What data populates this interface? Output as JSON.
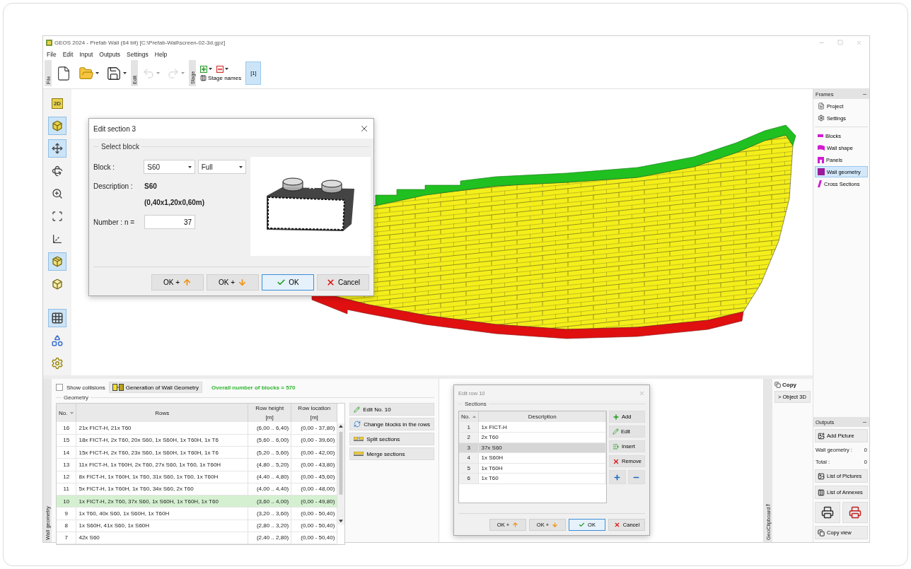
{
  "window": {
    "title": "GEOS 2024 - Prefab Wall (64 bit) [C:\\Prefab-Wall\\screen-02-3d.gpz]"
  },
  "menu": [
    "File",
    "Edit",
    "Input",
    "Outputs",
    "Settings",
    "Help"
  ],
  "toolbar": {
    "groups": [
      {
        "label": "File",
        "tools": [
          {
            "kind": "new",
            "dropdown": false,
            "disabled": false
          },
          {
            "kind": "open",
            "dropdown": true,
            "disabled": false
          },
          {
            "kind": "save",
            "dropdown": true,
            "disabled": false
          }
        ]
      },
      {
        "label": "Edit",
        "tools": [
          {
            "kind": "undo",
            "dropdown": true,
            "disabled": true
          },
          {
            "kind": "redo",
            "dropdown": true,
            "disabled": true
          }
        ]
      }
    ],
    "stage": {
      "label": "Stage",
      "add": {
        "dropdown": true
      },
      "remove": {
        "dropdown": true
      },
      "names": "Stage names",
      "tabs": [
        {
          "label": "[1]",
          "selected": true
        }
      ]
    }
  },
  "view_tools": [
    {
      "kind": "planar",
      "label": "2D",
      "selected": false
    },
    {
      "kind": "spatial",
      "selected": true
    },
    {
      "kind": "move",
      "selected": true
    },
    {
      "kind": "rotate",
      "selected": false
    },
    {
      "kind": "zoom",
      "selected": false
    },
    {
      "kind": "fit",
      "selected": false
    },
    {
      "kind": "axes",
      "selected": false
    },
    {
      "kind": "view-cube",
      "selected": true
    },
    {
      "kind": "view-iso",
      "selected": false
    }
  ],
  "display_tools": [
    {
      "kind": "table",
      "selected": true
    },
    {
      "kind": "legend",
      "selected": false
    },
    {
      "kind": "settings",
      "selected": false
    }
  ],
  "frames": {
    "title": "Frames",
    "general": [
      {
        "kind": "project",
        "label": "Project",
        "selected": false
      },
      {
        "kind": "settings",
        "label": "Settings",
        "selected": false
      }
    ],
    "input": [
      {
        "kind": "blocks",
        "label": "Blocks",
        "selected": false
      },
      {
        "kind": "wall-shape",
        "label": "Wall shape",
        "selected": false
      },
      {
        "kind": "panels",
        "label": "Panels",
        "selected": false
      },
      {
        "kind": "wall-geometry",
        "label": "Wall geometry",
        "selected": true
      },
      {
        "kind": "cross-sections",
        "label": "Cross Sections",
        "selected": false
      }
    ]
  },
  "edit_section_dialog": {
    "title": "Edit section 3",
    "fieldset": "Select block",
    "block": {
      "label": "Block :",
      "type": "S60",
      "variant": "Full"
    },
    "description": {
      "label": "Description :",
      "name": "S60",
      "size": "(0,40x1,20x0,60m)"
    },
    "number": {
      "label": "Number : n =",
      "value": "37"
    },
    "footer": [
      {
        "kind": "ok-up",
        "label": "OK +",
        "default": false
      },
      {
        "kind": "ok-down",
        "label": "OK +",
        "default": false
      },
      {
        "kind": "ok",
        "label": "OK",
        "default": true
      },
      {
        "kind": "cancel",
        "label": "Cancel",
        "default": false
      }
    ]
  },
  "geometry_panel": {
    "tab": "Wall geometry",
    "show_collisions": {
      "label": "Show collisions",
      "checked": false
    },
    "generate_button": "Generation of Wall Geometry",
    "summary": "Overall number of blocks = 570",
    "fieldset": "Geometry",
    "table": {
      "sort_descending": true,
      "columns": [
        {
          "label": "No.",
          "sorted": true
        },
        {
          "label": "Rows",
          "sorted": false
        },
        {
          "label": "Row height",
          "unit": "[m]",
          "sorted": false
        },
        {
          "label": "Row location",
          "unit": "[m]",
          "sorted": false
        }
      ],
      "rows": [
        {
          "no": "16",
          "rows": "21x FICT-H, 21x T60",
          "height": "(6,00 .. 6,40)",
          "location": "(0,00 - 37,80)",
          "selected": false
        },
        {
          "no": "15",
          "rows": "18x FICT-H, 2x T60, 20x S60, 1x S60H, 1x T60H, 1x T6",
          "height": "(5,60 .. 6,00)",
          "location": "(0,00 - 39,60)",
          "selected": false
        },
        {
          "no": "14",
          "rows": "15x FICT-H, 2x T60, 23x S60, 1x S60H, 1x T60H, 1x T6",
          "height": "(5,20 .. 5,60)",
          "location": "(0,00 - 42,00)",
          "selected": false
        },
        {
          "no": "13",
          "rows": "11x FICT-H, 1x T60H, 2x T60, 27x S60, 1x T60, 1x T60H",
          "height": "(4,80 .. 5,20)",
          "location": "(0,00 - 43,80)",
          "selected": false
        },
        {
          "no": "12",
          "rows": "8x FICT-H, 1x T60H, 1x T60, 31x S60, 1x T60, 1x T60H",
          "height": "(4,40 .. 4,80)",
          "location": "(0,00 - 45,60)",
          "selected": false
        },
        {
          "no": "11",
          "rows": "5x FICT-H, 1x T60H, 1x T60, 34x S60, 2x T60",
          "height": "(4,00 .. 4,40)",
          "location": "(0,00 - 48,00)",
          "selected": false
        },
        {
          "no": "10",
          "rows": "1x FICT-H, 2x T60, 37x S60, 1x S60H, 1x T60H, 1x T60",
          "height": "(3,60 .. 4,00)",
          "location": "(0,00 - 49,80)",
          "selected": true
        },
        {
          "no": "9",
          "rows": "1x T60, 40x S60, 1x S60H, 1x T60H",
          "height": "(3,20 .. 3,60)",
          "location": "(0,00 - 50,40)",
          "selected": false
        },
        {
          "no": "8",
          "rows": "1x S60H, 41x S60, 1x S60H",
          "height": "(2,80 .. 3,20)",
          "location": "(0,00 - 50,40)",
          "selected": false
        },
        {
          "no": "7",
          "rows": "42x S60",
          "height": "(2,40 .. 2,80)",
          "location": "(0,00 - 50,40)",
          "selected": false
        }
      ]
    },
    "actions": [
      {
        "kind": "edit",
        "label": "Edit No. 10"
      },
      {
        "kind": "change",
        "label": "Change blocks in the rows"
      },
      {
        "kind": "split",
        "label": "Split sections"
      },
      {
        "kind": "merge",
        "label": "Merge sections"
      }
    ]
  },
  "edit_row_dialog": {
    "title": "Edit row 10",
    "fieldset": "Sections",
    "sort_descending": false,
    "columns": [
      {
        "label": "No.",
        "sorted": true
      },
      {
        "label": "Description",
        "sorted": false
      }
    ],
    "rows": [
      {
        "no": "1",
        "description": "1x FICT-H",
        "selected": false
      },
      {
        "no": "2",
        "description": "2x T60",
        "selected": false
      },
      {
        "no": "3",
        "description": "37x S60",
        "selected": true
      },
      {
        "no": "4",
        "description": "1x S60H",
        "selected": false
      },
      {
        "no": "5",
        "description": "1x T60H",
        "selected": false
      },
      {
        "no": "6",
        "description": "1x T60",
        "selected": false
      }
    ],
    "buttons": [
      {
        "kind": "add",
        "label": "Add"
      },
      {
        "kind": "edit",
        "label": "Edit"
      },
      {
        "kind": "insert",
        "label": "Insert"
      },
      {
        "kind": "remove",
        "label": "Remove"
      }
    ],
    "step_buttons": [
      {
        "kind": "plus"
      },
      {
        "kind": "minus"
      }
    ],
    "footer": [
      {
        "kind": "ok-up",
        "label": "OK +",
        "default": false
      },
      {
        "kind": "ok-down",
        "label": "OK +",
        "default": false
      },
      {
        "kind": "ok",
        "label": "OK",
        "default": true
      },
      {
        "kind": "cancel",
        "label": "Cancel",
        "default": false
      }
    ]
  },
  "clipboard": {
    "tab": "GeoClipboard™",
    "copy": "Copy",
    "items": [
      "> Object 3D"
    ]
  },
  "outputs": {
    "title": "Outputs",
    "add_picture": "Add Picture",
    "counts": [
      {
        "label": "Wall geometry :",
        "value": "0"
      },
      {
        "label": "Total :",
        "value": "0"
      }
    ],
    "list_pictures": "List of Pictures",
    "list_annexes": "List of Annexes",
    "print_buttons": [
      {
        "kind": "print"
      },
      {
        "kind": "print-export"
      }
    ],
    "copy_view": "Copy view"
  }
}
